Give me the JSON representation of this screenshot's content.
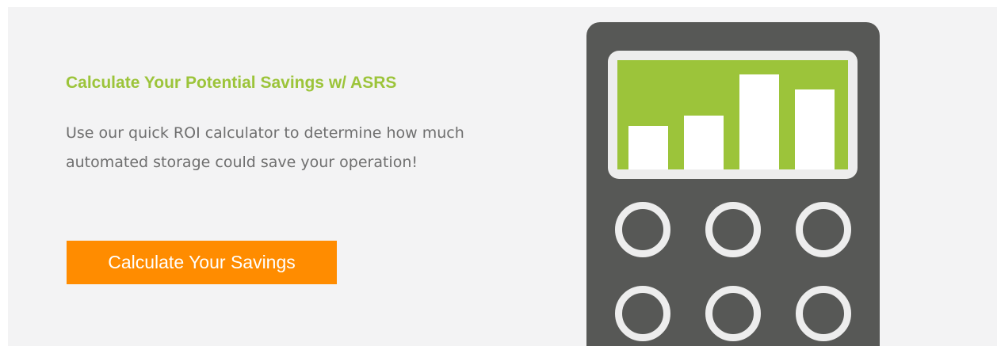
{
  "promo": {
    "headline": "Calculate Your Potential Savings w/ ASRS",
    "body": "Use our quick ROI calculator to determine how much automated storage could save your operation!",
    "cta_label": "Calculate Your Savings"
  },
  "illustration": {
    "icon": "calculator-icon",
    "screen_icon": "bar-chart-icon",
    "bar_levels": [
      0.4,
      0.49,
      0.87,
      0.73
    ],
    "key_rows": 2,
    "key_columns": 3
  },
  "colors": {
    "accent_green": "#9cc43a",
    "cta_orange": "#ff8c00",
    "calculator_body": "#575856",
    "panel_background": "#f3f3f4",
    "body_text": "#6f6f6f"
  }
}
